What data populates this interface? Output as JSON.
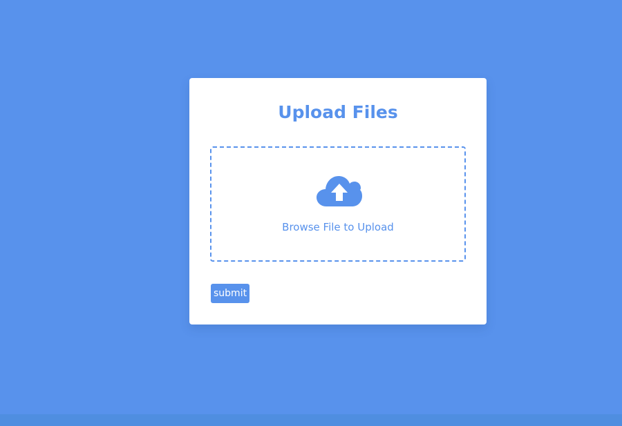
{
  "card": {
    "title": "Upload Files",
    "dropzone": {
      "icon": "cloud-upload-icon",
      "text": "Browse File to Upload"
    },
    "submit_label": "submit"
  },
  "colors": {
    "background": "#5892ec",
    "accent": "#5892ec",
    "card": "#ffffff"
  }
}
